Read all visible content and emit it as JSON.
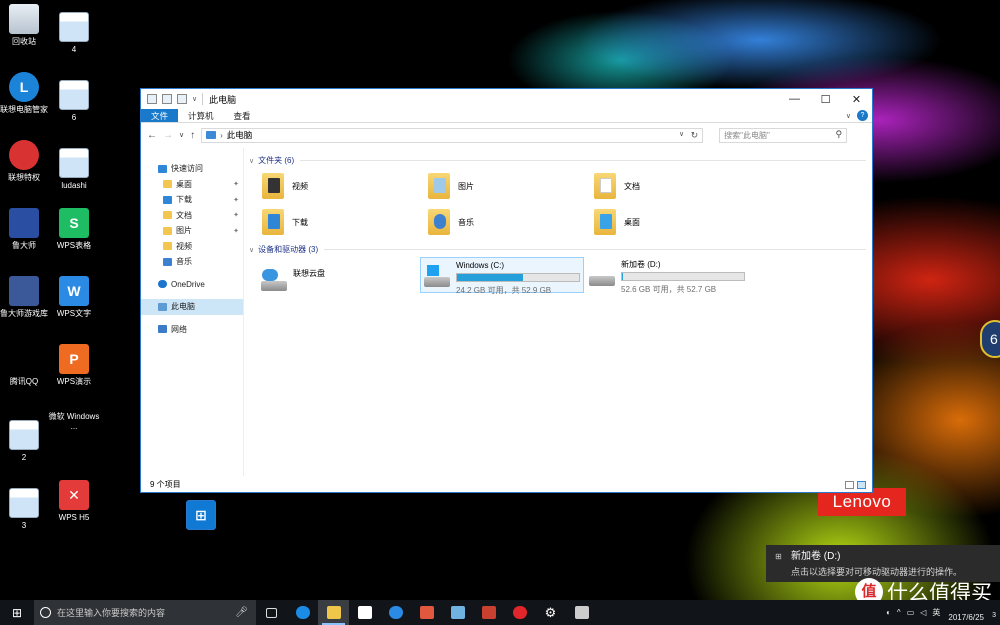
{
  "desktop": {
    "brand": "Lenovo",
    "side_badge": "6",
    "icons": [
      {
        "label": "回收站"
      },
      {
        "label": "4"
      },
      {
        "label": "联想电脑管家"
      },
      {
        "label": "6"
      },
      {
        "label": "联想特权"
      },
      {
        "label": "ludashi"
      },
      {
        "label": "鲁大师"
      },
      {
        "label": "WPS表格"
      },
      {
        "label": "鲁大师游戏库"
      },
      {
        "label": "WPS文字"
      },
      {
        "label": "腾讯QQ"
      },
      {
        "label": "WPS演示"
      },
      {
        "label": "2"
      },
      {
        "label": "微软 Windows ..."
      },
      {
        "label": "3"
      },
      {
        "label": "WPS H5"
      }
    ]
  },
  "explorer": {
    "title": "此电脑",
    "window_controls": {
      "minimize": "—",
      "maximize": "☐",
      "close": "✕"
    },
    "ribbon_tabs": [
      "文件",
      "计算机",
      "查看"
    ],
    "address": "此电脑",
    "search_placeholder": "搜索\"此电脑\"",
    "nav": {
      "quick_access": "快速访问",
      "quick_items": [
        "桌面",
        "下载",
        "文档",
        "图片",
        "视频",
        "音乐"
      ],
      "onedrive": "OneDrive",
      "this_pc": "此电脑",
      "network": "网络"
    },
    "folders_header": "文件夹 (6)",
    "folders": [
      "视频",
      "图片",
      "文档",
      "下载",
      "音乐",
      "桌面"
    ],
    "devices_header": "设备和驱动器 (3)",
    "devices": [
      {
        "name": "联想云盘"
      },
      {
        "name": "Windows (C:)",
        "free_text": "24.2 GB 可用，共 52.9 GB",
        "used_fraction": 0.54
      },
      {
        "name": "新加卷 (D:)",
        "free_text": "52.6 GB 可用，共 52.7 GB",
        "used_fraction": 0.002
      }
    ],
    "status": "9 个项目"
  },
  "toast": {
    "title": "新加卷 (D:)",
    "message": "点击以选择要对可移动驱动器进行的操作。"
  },
  "taskbar": {
    "search_placeholder": "在这里输入你要搜索的内容",
    "date": "2017/6/25",
    "ime": "英",
    "notify_count": "3"
  },
  "watermark": "什么值得买"
}
